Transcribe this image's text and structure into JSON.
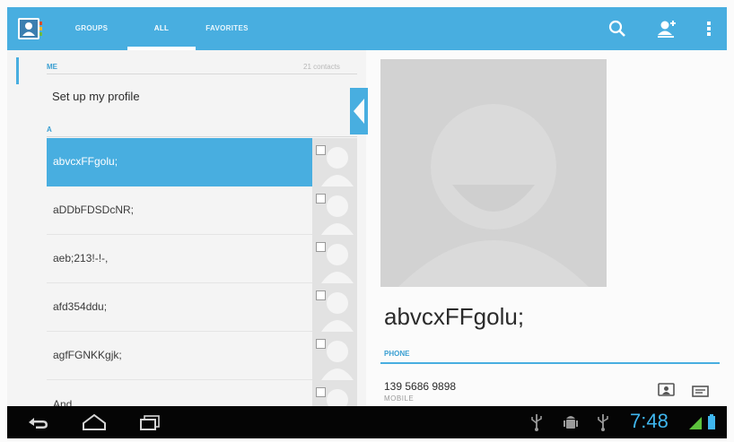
{
  "actionbar": {
    "app_icon": "contacts-app-icon",
    "tabs": [
      {
        "label": "GROUPS",
        "selected": false
      },
      {
        "label": "ALL",
        "selected": true
      },
      {
        "label": "FAVORITES",
        "selected": false
      }
    ],
    "icons": [
      "search-icon",
      "add-contact-icon",
      "overflow-menu-icon"
    ]
  },
  "list": {
    "me_header": "ME",
    "me_count": "21 contacts",
    "profile_label": "Set up my profile",
    "a_header": "A",
    "contacts": [
      {
        "name": "abvcxFFgolu;",
        "selected": true
      },
      {
        "name": "aDDbFDSDcNR;",
        "selected": false
      },
      {
        "name": "aeb;213!-!-,",
        "selected": false
      },
      {
        "name": "afd354ddu;",
        "selected": false
      },
      {
        "name": "agfFGNKKgjk;",
        "selected": false
      },
      {
        "name": "And",
        "selected": false
      }
    ]
  },
  "detail": {
    "name": "abvcxFFgolu;",
    "phone_header": "PHONE",
    "phone_number": "139 5686 9898",
    "phone_type": "MOBILE"
  },
  "status": {
    "time": "7:48"
  },
  "colors": {
    "accent": "#48aee0",
    "navbar": "#050505",
    "clock": "#3fb6ee"
  }
}
